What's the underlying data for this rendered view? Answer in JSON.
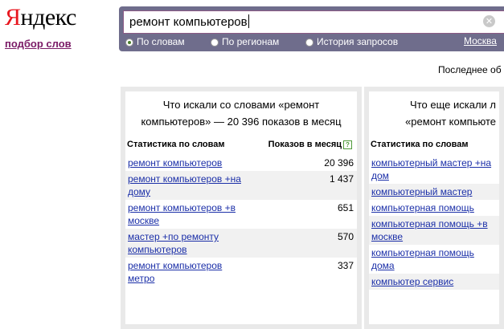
{
  "logo": {
    "first": "Я",
    "rest": "ндекс"
  },
  "subnav": "подбор слов",
  "search": {
    "query": "ремонт компьютеров"
  },
  "radios": [
    {
      "label": "По словам",
      "selected": true
    },
    {
      "label": "По регионам",
      "selected": false
    },
    {
      "label": "История запросов",
      "selected": false
    }
  ],
  "region": "Москва",
  "updated": "Последнее об",
  "left": {
    "title_line1": "Что искали со словами «ремонт",
    "title_line2": "компьютеров» — 20 396 показов в месяц",
    "col_words": "Статистика по словам",
    "col_shows": "Показов в месяц",
    "help": "?",
    "rows": [
      {
        "l1": "ремонт компьютеров",
        "l2": "",
        "n": "20 396"
      },
      {
        "l1": "ремонт компьютеров +на",
        "l2": "дому",
        "n": "1 437"
      },
      {
        "l1": "ремонт компьютеров +в",
        "l2": "москве",
        "n": "651"
      },
      {
        "l1": "мастер +по ремонту",
        "l2": "компьютеров",
        "n": "570"
      },
      {
        "l1": "ремонт компьютеров",
        "l2": "метро",
        "n": "337"
      }
    ]
  },
  "right": {
    "title_line1": "Что еще искали л",
    "title_line2": "«ремонт компьюте",
    "col_words": "Статистика по словам",
    "rows": [
      {
        "l1": "компьютерный мастер +на",
        "l2": "дом"
      },
      {
        "l1": "компьютерный мастер",
        "l2": ""
      },
      {
        "l1": "компьютерная помощь",
        "l2": ""
      },
      {
        "l1": "компьютерная помощь +в",
        "l2": "москве"
      },
      {
        "l1": "компьютерная помощь",
        "l2": "дома"
      },
      {
        "l1": "компьютер сервис",
        "l2": ""
      }
    ]
  }
}
